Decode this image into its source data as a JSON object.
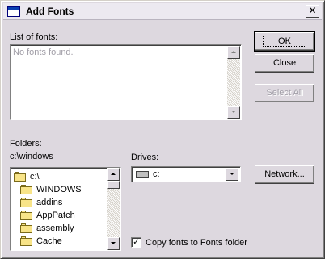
{
  "window": {
    "title": "Add Fonts",
    "close_glyph": "✕"
  },
  "fonts_list": {
    "label": "List of fonts:",
    "empty_text": "No fonts found."
  },
  "buttons": {
    "ok": "OK",
    "close": "Close",
    "select_all": "Select All",
    "network": "Network..."
  },
  "folders": {
    "label": "Folders:",
    "current_path": "c:\\windows",
    "items": [
      {
        "name": "c:\\",
        "icon": "open-folder-icon"
      },
      {
        "name": "WINDOWS",
        "icon": "open-folder-icon"
      },
      {
        "name": "addins",
        "icon": "folder-icon"
      },
      {
        "name": "AppPatch",
        "icon": "folder-icon"
      },
      {
        "name": "assembly",
        "icon": "folder-icon"
      },
      {
        "name": "Cache",
        "icon": "folder-icon"
      }
    ]
  },
  "drives": {
    "label": "Drives:",
    "selected": "c:",
    "icon": "hard-drive-icon"
  },
  "copy_option": {
    "label": "Copy fonts to Fonts folder",
    "checked": true
  },
  "colors": {
    "dialog_bg": "#ddd8df",
    "disabled_text": "#a09da6"
  }
}
